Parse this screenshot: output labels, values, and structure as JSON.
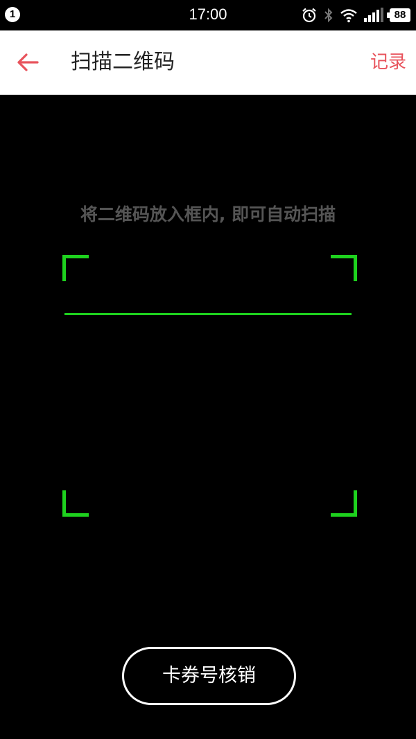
{
  "status_bar": {
    "notification_count": "1",
    "time": "17:00",
    "battery": "88",
    "icons": [
      "alarm-icon",
      "bluetooth-icon",
      "wifi-icon",
      "signal-icon",
      "battery-icon"
    ]
  },
  "header": {
    "back_icon": "arrow-left-icon",
    "title": "扫描二维码",
    "record_label": "记录"
  },
  "scanner": {
    "hint": "将二维码放入框内, 即可自动扫描",
    "frame_color": "#1ed21e"
  },
  "actions": {
    "coupon_verify_label": "卡券号核销"
  },
  "colors": {
    "accent": "#e8535c",
    "scan_green": "#1ed21e",
    "background": "#000000"
  }
}
